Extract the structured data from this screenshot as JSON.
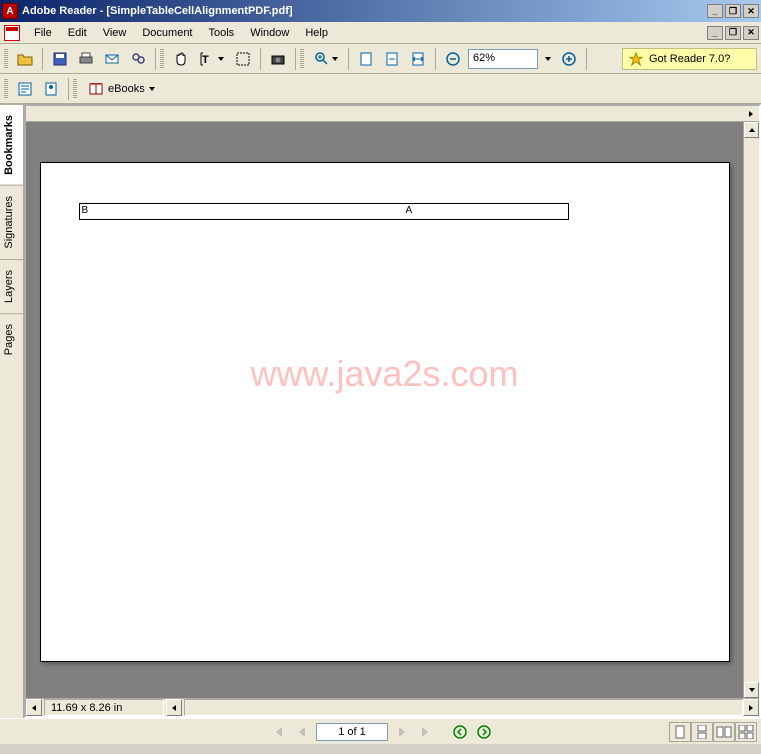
{
  "titlebar": {
    "text": "Adobe Reader - [SimpleTableCellAlignmentPDF.pdf]"
  },
  "menu": {
    "file": "File",
    "edit": "Edit",
    "view": "View",
    "document": "Document",
    "tools": "Tools",
    "window": "Window",
    "help": "Help"
  },
  "toolbar": {
    "zoom_value": "62%",
    "promo_text": "Got Reader 7.0?",
    "ebooks_label": "eBooks"
  },
  "side_tabs": {
    "bookmarks": "Bookmarks",
    "signatures": "Signatures",
    "layers": "Layers",
    "pages": "Pages"
  },
  "document": {
    "table_cell_b": "B",
    "table_cell_a": "A",
    "watermark": "www.java2s.com"
  },
  "status": {
    "dimensions": "11.69 x 8.26 in",
    "page_indicator": "1 of 1"
  }
}
